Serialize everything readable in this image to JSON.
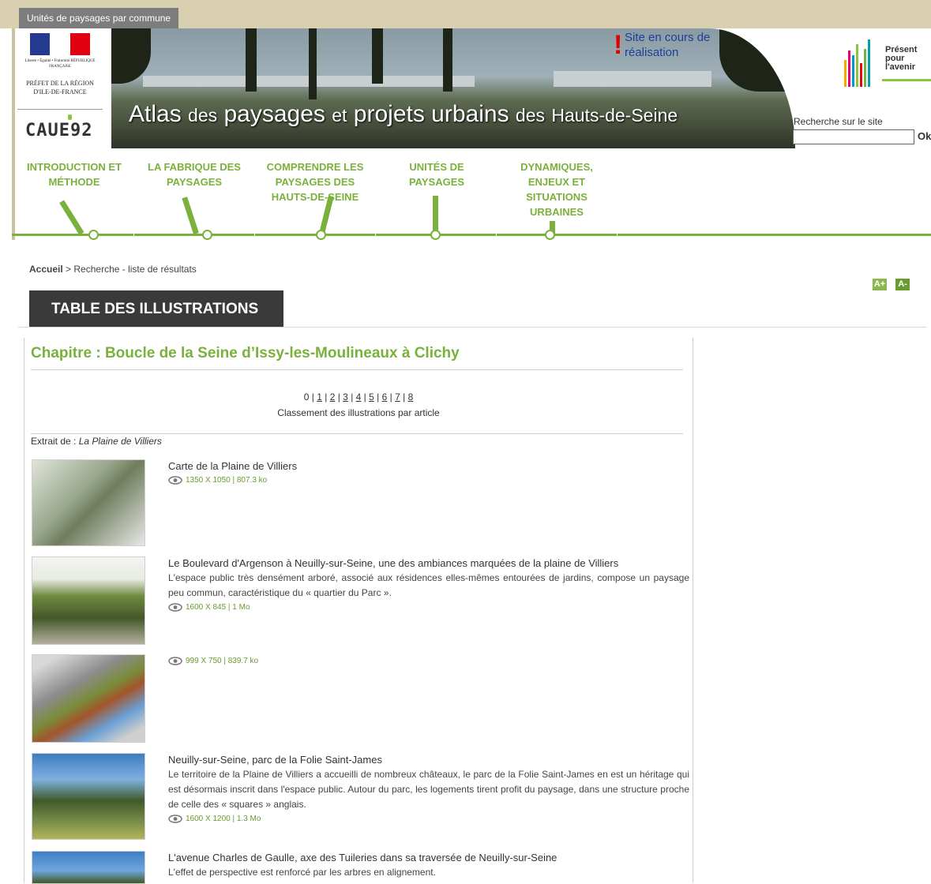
{
  "top_tab": "Unités de paysages par commune",
  "rf_logo": {
    "republique": "Liberté • Égalité • Fraternité RÉPUBLIQUE FRANÇAISE",
    "prefet": "PRÉFET DE LA RÉGION D'ILE-DE-FRANCE"
  },
  "caue_logo": "CAUE92",
  "banner": {
    "site_status": "Site en cours de réalisation",
    "title_a": "Atlas",
    "title_b": "des",
    "title_c": "paysages",
    "title_d": "et",
    "title_e": "projets urbains",
    "title_f": "des",
    "title_g": "Hauts-de-Seine"
  },
  "present_logo": "Présent pour l'avenir",
  "search": {
    "label": "Recherche sur le site",
    "value": "",
    "ok": "Ok"
  },
  "nav": [
    {
      "label": "INTRODUCTION ET MÉTHODE"
    },
    {
      "label": "LA FABRIQUE DES PAYSAGES"
    },
    {
      "label": "COMPRENDRE LES PAYSAGES DES HAUTS-DE-SEINE"
    },
    {
      "label": "UNITÉS DE PAYSAGES"
    },
    {
      "label": "DYNAMIQUES, ENJEUX ET SITUATIONS URBAINES"
    }
  ],
  "breadcrumb": {
    "home": "Accueil",
    "separator": ">",
    "current": "Recherche - liste de résultats"
  },
  "font_controls": {
    "increase": "A+",
    "decrease": "A-"
  },
  "page_title": "TABLE DES ILLUSTRATIONS",
  "chapter": "Chapitre : Boucle de la Seine d’Issy-les-Moulineaux à Clichy",
  "pagination": {
    "current": "0",
    "pages": [
      "1",
      "2",
      "3",
      "4",
      "5",
      "6",
      "7",
      "8"
    ]
  },
  "classement": "Classement des illustrations par article",
  "extrait": {
    "prefix": "Extrait de :",
    "article": "La Plaine de Villiers"
  },
  "items": [
    {
      "title": "Carte de la Plaine de Villiers",
      "desc": "",
      "meta": "1350 X 1050 | 807.3 ko",
      "thumb_icon": "map-thumbnail-icon"
    },
    {
      "title": "Le Boulevard d'Argenson à Neuilly-sur-Seine, une des ambiances marquées de la plaine de Villiers",
      "desc": "L'espace public très densément arboré, associé aux résidences elles-mêmes entourées de jardins, compose un paysage peu commun, caractéristique du « quartier du Parc ».",
      "meta": "1600 X 845 | 1 Mo",
      "thumb_icon": "photo-thumbnail-icon"
    },
    {
      "title": "",
      "desc": "",
      "meta": "999 X 750 | 839.7 ko",
      "thumb_icon": "aerial-map-thumbnail-icon"
    },
    {
      "title": "Neuilly-sur-Seine, parc de la Folie Saint-James",
      "desc": "Le territoire de la Plaine de Villiers a accueilli de nombreux châteaux, le parc de la Folie Saint-James en est un héritage qui est désormais inscrit dans l'espace public. Autour du parc, les logements tirent profit du paysage, dans une structure proche de celle des « squares » anglais.",
      "meta": "1600 X 1200 | 1.3 Mo",
      "thumb_icon": "photo-thumbnail-icon"
    },
    {
      "title": "L'avenue Charles de Gaulle, axe des Tuileries dans sa traversée de Neuilly-sur-Seine",
      "desc": "L'effet de perspective est renforcé par les arbres en alignement.",
      "meta": "",
      "thumb_icon": "photo-thumbnail-icon"
    }
  ],
  "colors": {
    "accent_green": "#7ab13c",
    "dark_tab": "#3a3a3a",
    "topbar": "#d8d0b0",
    "alert_red": "#e30000",
    "banner_blue_text": "#1d3f9a"
  }
}
